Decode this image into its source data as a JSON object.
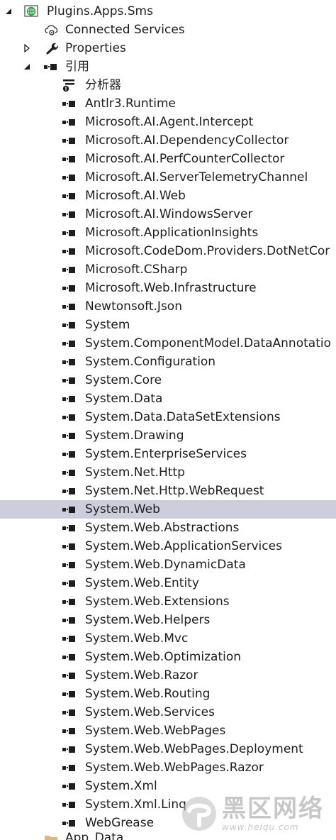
{
  "project": {
    "name": "Plugins.Apps.Sms"
  },
  "connected_services": {
    "label": "Connected Services"
  },
  "properties": {
    "label": "Properties"
  },
  "references": {
    "label": "引用"
  },
  "analyzers": {
    "label": "分析器"
  },
  "reference_items": [
    "Antlr3.Runtime",
    "Microsoft.AI.Agent.Intercept",
    "Microsoft.AI.DependencyCollector",
    "Microsoft.AI.PerfCounterCollector",
    "Microsoft.AI.ServerTelemetryChannel",
    "Microsoft.AI.Web",
    "Microsoft.AI.WindowsServer",
    "Microsoft.ApplicationInsights",
    "Microsoft.CodeDom.Providers.DotNetCor",
    "Microsoft.CSharp",
    "Microsoft.Web.Infrastructure",
    "Newtonsoft.Json",
    "System",
    "System.ComponentModel.DataAnnotatio",
    "System.Configuration",
    "System.Core",
    "System.Data",
    "System.Data.DataSetExtensions",
    "System.Drawing",
    "System.EnterpriseServices",
    "System.Net.Http",
    "System.Net.Http.WebRequest",
    "System.Web",
    "System.Web.Abstractions",
    "System.Web.ApplicationServices",
    "System.Web.DynamicData",
    "System.Web.Entity",
    "System.Web.Extensions",
    "System.Web.Helpers",
    "System.Web.Mvc",
    "System.Web.Optimization",
    "System.Web.Razor",
    "System.Web.Routing",
    "System.Web.Services",
    "System.Web.WebPages",
    "System.Web.WebPages.Deployment",
    "System.Web.WebPages.Razor",
    "System.Xml",
    "System.Xml.Linq",
    "WebGrease"
  ],
  "selected_item": "System.Web",
  "partial_next": {
    "label": "App_Data"
  },
  "watermark": {
    "text": "黑区网络",
    "url": "www.heiqu.com"
  },
  "colors": {
    "selection": "#cccedb",
    "text": "#1e1e1e",
    "project_icon": "#2a9d3e"
  }
}
